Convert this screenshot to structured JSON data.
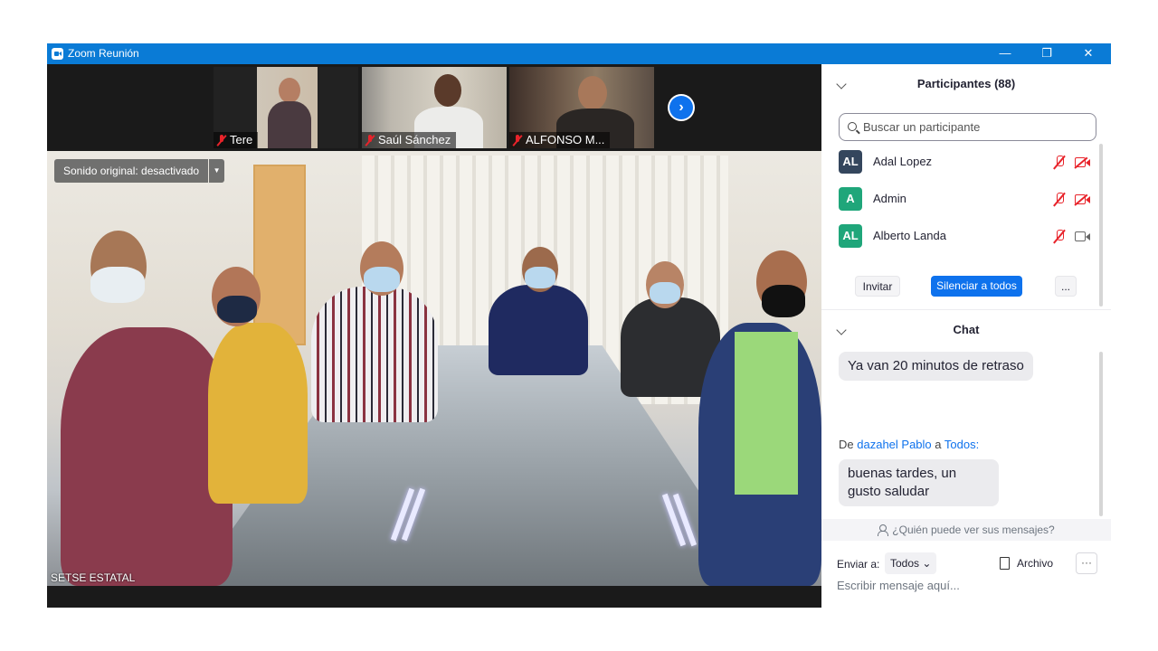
{
  "window": {
    "title": "Zoom Reunión",
    "controls": {
      "minimize": "—",
      "restore": "❐",
      "close": "✕"
    }
  },
  "thumbnails": [
    {
      "name": "Tere",
      "muted": true
    },
    {
      "name": "Saúl Sánchez",
      "muted": true
    },
    {
      "name": "ALFONSO M...",
      "muted": true
    }
  ],
  "next_page_icon": "chevron-right-icon",
  "main_video": {
    "sound_button": "Sonido original: desactivado",
    "sound_dropdown": "▼",
    "label": "SETSE ESTATAL"
  },
  "participants": {
    "header": "Participantes (88)",
    "search_placeholder": "Buscar un participante",
    "list": [
      {
        "initials": "AL",
        "name": "Adal Lopez",
        "color": "#34465d",
        "mic": "muted",
        "video": "off"
      },
      {
        "initials": "A",
        "name": "Admin",
        "color": "#1fa67a",
        "mic": "muted",
        "video": "off"
      },
      {
        "initials": "AL",
        "name": "Alberto Landa",
        "color": "#1fa67a",
        "mic": "muted",
        "video": "on"
      }
    ],
    "buttons": {
      "invite": "Invitar",
      "mute_all": "Silenciar a todos",
      "more": "..."
    }
  },
  "chat": {
    "header": "Chat",
    "messages": [
      {
        "text": "Ya van 20 minutos de retraso"
      },
      {
        "from_prefix": "De",
        "from": "dazahel Pablo",
        "to_prefix": "a",
        "to": "Todos:",
        "text": "buenas tardes, un gusto saludar"
      }
    ],
    "who_can_see": "¿Quién puede ver sus mensajes?",
    "send_to_label": "Enviar a:",
    "send_to_value": "Todos",
    "file_label": "Archivo",
    "more": "···",
    "input_placeholder": "Escribir mensaje aquí..."
  },
  "colors": {
    "titlebar": "#0a7bd6",
    "accent": "#0e72ed",
    "muted_red": "#e8232a"
  }
}
